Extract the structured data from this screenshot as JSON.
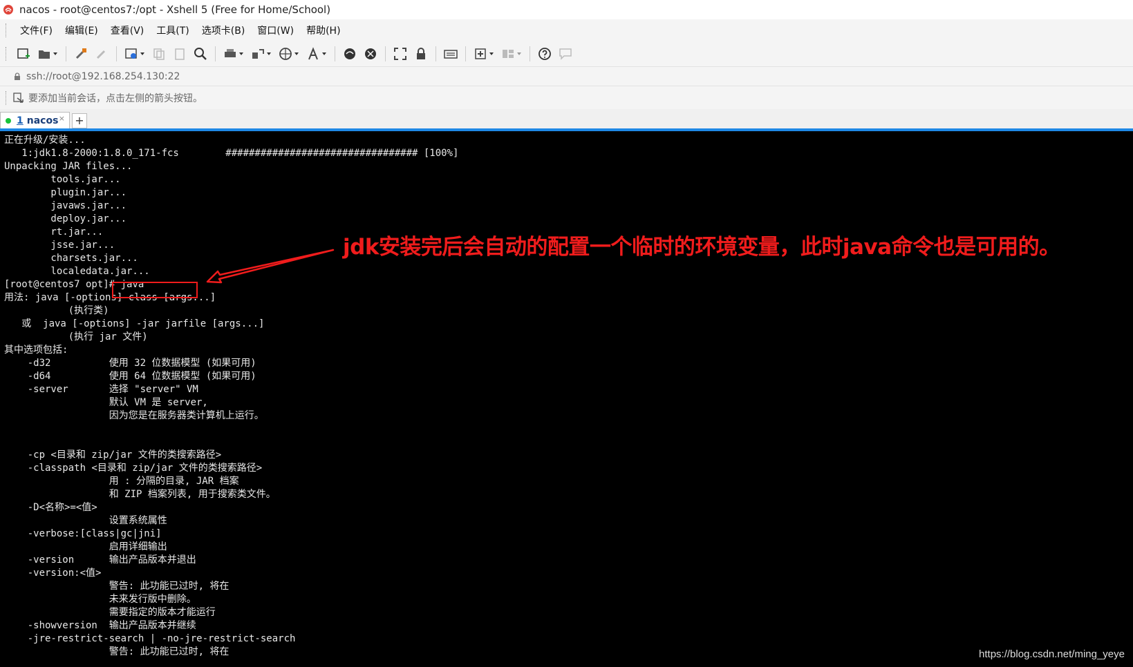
{
  "window": {
    "title": "nacos - root@centos7:/opt - Xshell 5 (Free for Home/School)"
  },
  "menu": {
    "items": [
      "文件(F)",
      "编辑(E)",
      "查看(V)",
      "工具(T)",
      "选项卡(B)",
      "窗口(W)",
      "帮助(H)"
    ]
  },
  "address": {
    "url": "ssh://root@192.168.254.130:22"
  },
  "hint": {
    "text": "要添加当前会话，点击左侧的箭头按钮。"
  },
  "tabs": {
    "active": {
      "number": "1",
      "name": "nacos",
      "close": "×",
      "status_color": "#19c33a"
    },
    "new_tab": "+"
  },
  "terminal": {
    "lines": [
      "正在升级/安装...",
      "   1:jdk1.8-2000:1.8.0_171-fcs        ################################# [100%]",
      "Unpacking JAR files...",
      "        tools.jar...",
      "        plugin.jar...",
      "        javaws.jar...",
      "        deploy.jar...",
      "        rt.jar...",
      "        jsse.jar...",
      "        charsets.jar...",
      "        localedata.jar...",
      "[root@centos7 opt]# java",
      "用法: java [-options] class [args...]",
      "           (执行类)",
      "   或  java [-options] -jar jarfile [args...]",
      "           (执行 jar 文件)",
      "其中选项包括:",
      "    -d32          使用 32 位数据模型 (如果可用)",
      "    -d64          使用 64 位数据模型 (如果可用)",
      "    -server       选择 \"server\" VM",
      "                  默认 VM 是 server,",
      "                  因为您是在服务器类计算机上运行。",
      "",
      "",
      "    -cp <目录和 zip/jar 文件的类搜索路径>",
      "    -classpath <目录和 zip/jar 文件的类搜索路径>",
      "                  用 : 分隔的目录, JAR 档案",
      "                  和 ZIP 档案列表, 用于搜索类文件。",
      "    -D<名称>=<值>",
      "                  设置系统属性",
      "    -verbose:[class|gc|jni]",
      "                  启用详细输出",
      "    -version      输出产品版本并退出",
      "    -version:<值>",
      "                  警告: 此功能已过时, 将在",
      "                  未来发行版中删除。",
      "                  需要指定的版本才能运行",
      "    -showversion  输出产品版本并继续",
      "    -jre-restrict-search | -no-jre-restrict-search",
      "                  警告: 此功能已过时, 将在"
    ]
  },
  "annotation": {
    "text": "jdk安装完后会自动的配置一个临时的环境变量，此时java命令也是可用的。",
    "color": "#f01c1c"
  },
  "watermark": {
    "text": "https://blog.csdn.net/ming_yeye"
  },
  "colors": {
    "accent_tab_line": "#1e88e5",
    "terminal_bg": "#000000",
    "terminal_fg": "#e8e8e8"
  }
}
